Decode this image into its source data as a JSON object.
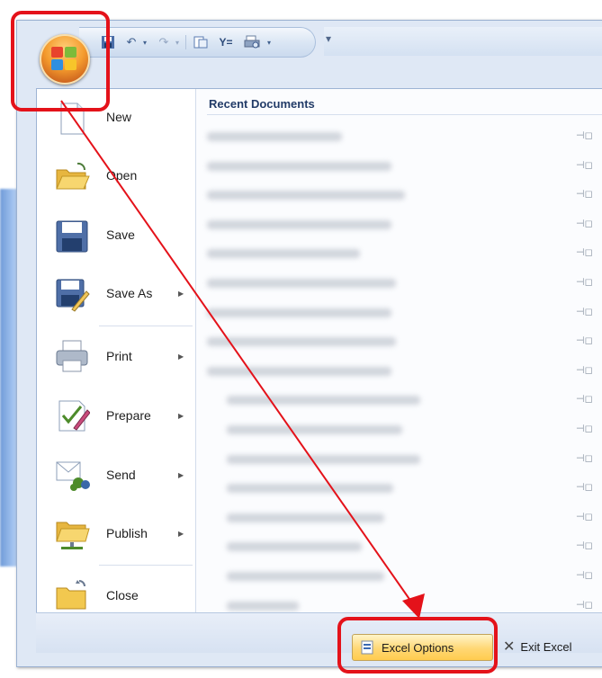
{
  "quick_access": {
    "customize_label": "▾"
  },
  "menu": {
    "items": [
      {
        "label": "New",
        "has_submenu": false
      },
      {
        "label": "Open",
        "has_submenu": false
      },
      {
        "label": "Save",
        "has_submenu": false
      },
      {
        "label": "Save As",
        "has_submenu": true
      },
      {
        "label": "Print",
        "has_submenu": true
      },
      {
        "label": "Prepare",
        "has_submenu": true
      },
      {
        "label": "Send",
        "has_submenu": true
      },
      {
        "label": "Publish",
        "has_submenu": true
      },
      {
        "label": "Close",
        "has_submenu": false
      }
    ],
    "arrow_glyph": "▶"
  },
  "recent": {
    "title": "Recent Documents",
    "pin_glyph": "⊣◻",
    "count": 17
  },
  "bottom": {
    "options_label": "Excel Options",
    "exit_label": "Exit Excel"
  },
  "colors": {
    "annotation": "#e4121a",
    "options_highlight": "#ffd774"
  }
}
